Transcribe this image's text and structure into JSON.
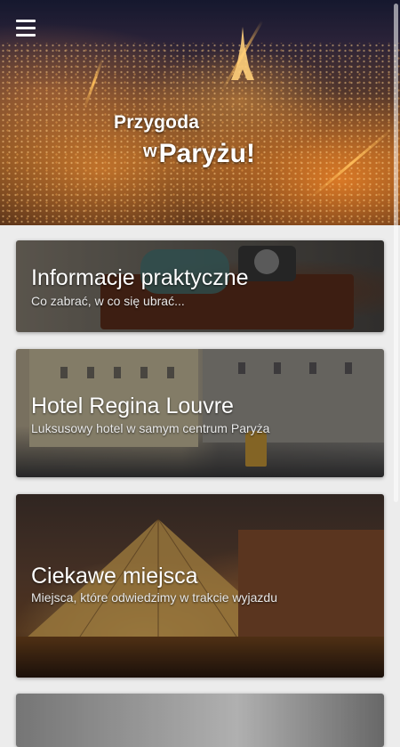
{
  "header": {
    "menu_icon": "hamburger-menu-icon",
    "title_line1": "Przygoda",
    "title_w": "w",
    "title_line2": "Paryżu!"
  },
  "cards": [
    {
      "title": "Informacje praktyczne",
      "subtitle": "Co zabrać, w co się ubrać..."
    },
    {
      "title": "Hotel Regina Louvre",
      "subtitle": "Luksusowy hotel w samym centrum Paryża"
    },
    {
      "title": "Ciekawe miejsca",
      "subtitle": "Miejsca, które odwiedzimy w trakcie wyjazdu"
    },
    {
      "title": "",
      "subtitle": ""
    }
  ]
}
